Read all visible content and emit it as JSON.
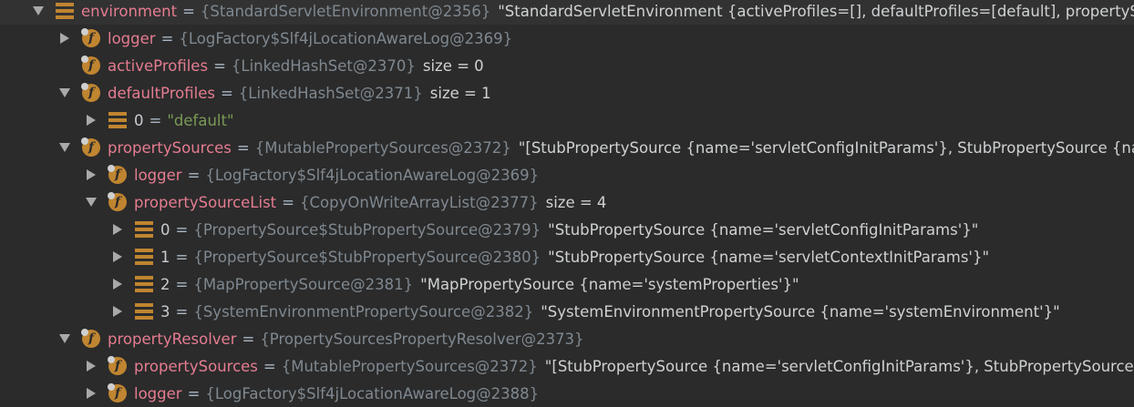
{
  "tree": [
    {
      "indent": 0,
      "expander": "down",
      "icon": "stack-icon",
      "name": "environment",
      "ref": "{StandardServletEnvironment@2356}",
      "value": "\"StandardServletEnvironment {activeProfiles=[], defaultProfiles=[default], propertySo",
      "value_color": "#cfd1d3"
    },
    {
      "indent": 1,
      "expander": "right",
      "icon": "field-icon",
      "name": "logger",
      "ref": "{LogFactory$Slf4jLocationAwareLog@2369}",
      "value": "",
      "value_color": "#cfd1d3"
    },
    {
      "indent": 1,
      "expander": "none",
      "icon": "field-icon",
      "name": "activeProfiles",
      "ref": "{LinkedHashSet@2370}",
      "value": "size = 0",
      "value_color": "#cfd1d3"
    },
    {
      "indent": 1,
      "expander": "down",
      "icon": "field-icon",
      "name": "defaultProfiles",
      "ref": "{LinkedHashSet@2371}",
      "value": "size = 1",
      "value_color": "#cfd1d3"
    },
    {
      "indent": 2,
      "expander": "right",
      "icon": "array-element-icon",
      "name": "0",
      "ref": "",
      "value": "\"default\"",
      "value_color": "#7a9a55"
    },
    {
      "indent": 1,
      "expander": "down",
      "icon": "field-icon",
      "name": "propertySources",
      "ref": "{MutablePropertySources@2372}",
      "value": "\"[StubPropertySource {name='servletConfigInitParams'}, StubPropertySource {na",
      "value_color": "#cfd1d3"
    },
    {
      "indent": 2,
      "expander": "right",
      "icon": "field-icon",
      "name": "logger",
      "ref": "{LogFactory$Slf4jLocationAwareLog@2369}",
      "value": "",
      "value_color": "#cfd1d3"
    },
    {
      "indent": 2,
      "expander": "down",
      "icon": "field-icon",
      "name": "propertySourceList",
      "ref": "{CopyOnWriteArrayList@2377}",
      "value": "size = 4",
      "value_color": "#cfd1d3"
    },
    {
      "indent": 3,
      "expander": "right",
      "icon": "array-element-icon",
      "name": "0",
      "ref": "{PropertySource$StubPropertySource@2379}",
      "value": "\"StubPropertySource {name='servletConfigInitParams'}\"",
      "value_color": "#cfd1d3"
    },
    {
      "indent": 3,
      "expander": "right",
      "icon": "array-element-icon",
      "name": "1",
      "ref": "{PropertySource$StubPropertySource@2380}",
      "value": "\"StubPropertySource {name='servletContextInitParams'}\"",
      "value_color": "#cfd1d3"
    },
    {
      "indent": 3,
      "expander": "right",
      "icon": "array-element-icon",
      "name": "2",
      "ref": "{MapPropertySource@2381}",
      "value": "\"MapPropertySource {name='systemProperties'}\"",
      "value_color": "#cfd1d3"
    },
    {
      "indent": 3,
      "expander": "right",
      "icon": "array-element-icon",
      "name": "3",
      "ref": "{SystemEnvironmentPropertySource@2382}",
      "value": "\"SystemEnvironmentPropertySource {name='systemEnvironment'}\"",
      "value_color": "#cfd1d3"
    },
    {
      "indent": 1,
      "expander": "down",
      "icon": "field-icon",
      "name": "propertyResolver",
      "ref": "{PropertySourcesPropertyResolver@2373}",
      "value": "",
      "value_color": "#cfd1d3"
    },
    {
      "indent": 2,
      "expander": "right",
      "icon": "field-icon",
      "name": "propertySources",
      "ref": "{MutablePropertySources@2372}",
      "value": "\"[StubPropertySource {name='servletConfigInitParams'}, StubPropertySource",
      "value_color": "#cfd1d3"
    },
    {
      "indent": 2,
      "expander": "right",
      "icon": "field-icon",
      "name": "logger",
      "ref": "{LogFactory$Slf4jLocationAwareLog@2388}",
      "value": "",
      "value_color": "#cfd1d3"
    }
  ],
  "labels": {
    "equals": "=",
    "field_glyph": "f"
  },
  "colors": {
    "background": "#2b2b2b",
    "name": "#e57c90",
    "index_name": "#c8cbcf",
    "ref": "#7f8890",
    "icon": "#c08530"
  }
}
